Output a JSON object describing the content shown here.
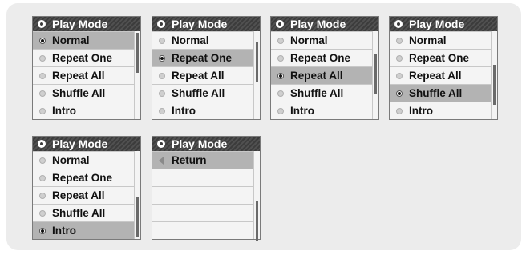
{
  "panels": [
    {
      "title": "Play Mode",
      "items": [
        {
          "label": "Normal",
          "selected": true
        },
        {
          "label": "Repeat One",
          "selected": false
        },
        {
          "label": "Repeat All",
          "selected": false
        },
        {
          "label": "Shuffle All",
          "selected": false
        },
        {
          "label": "Intro",
          "selected": false
        }
      ]
    },
    {
      "title": "Play Mode",
      "items": [
        {
          "label": "Normal",
          "selected": false
        },
        {
          "label": "Repeat One",
          "selected": true
        },
        {
          "label": "Repeat All",
          "selected": false
        },
        {
          "label": "Shuffle All",
          "selected": false
        },
        {
          "label": "Intro",
          "selected": false
        }
      ]
    },
    {
      "title": "Play Mode",
      "items": [
        {
          "label": "Normal",
          "selected": false
        },
        {
          "label": "Repeat One",
          "selected": false
        },
        {
          "label": "Repeat All",
          "selected": true
        },
        {
          "label": "Shuffle All",
          "selected": false
        },
        {
          "label": "Intro",
          "selected": false
        }
      ]
    },
    {
      "title": "Play Mode",
      "items": [
        {
          "label": "Normal",
          "selected": false
        },
        {
          "label": "Repeat One",
          "selected": false
        },
        {
          "label": "Repeat All",
          "selected": false
        },
        {
          "label": "Shuffle All",
          "selected": true
        },
        {
          "label": "Intro",
          "selected": false
        }
      ]
    },
    {
      "title": "Play Mode",
      "items": [
        {
          "label": "Normal",
          "selected": false
        },
        {
          "label": "Repeat One",
          "selected": false
        },
        {
          "label": "Repeat All",
          "selected": false
        },
        {
          "label": "Shuffle All",
          "selected": false
        },
        {
          "label": "Intro",
          "selected": true
        }
      ]
    },
    {
      "title": "Play Mode",
      "return_label": "Return"
    }
  ]
}
